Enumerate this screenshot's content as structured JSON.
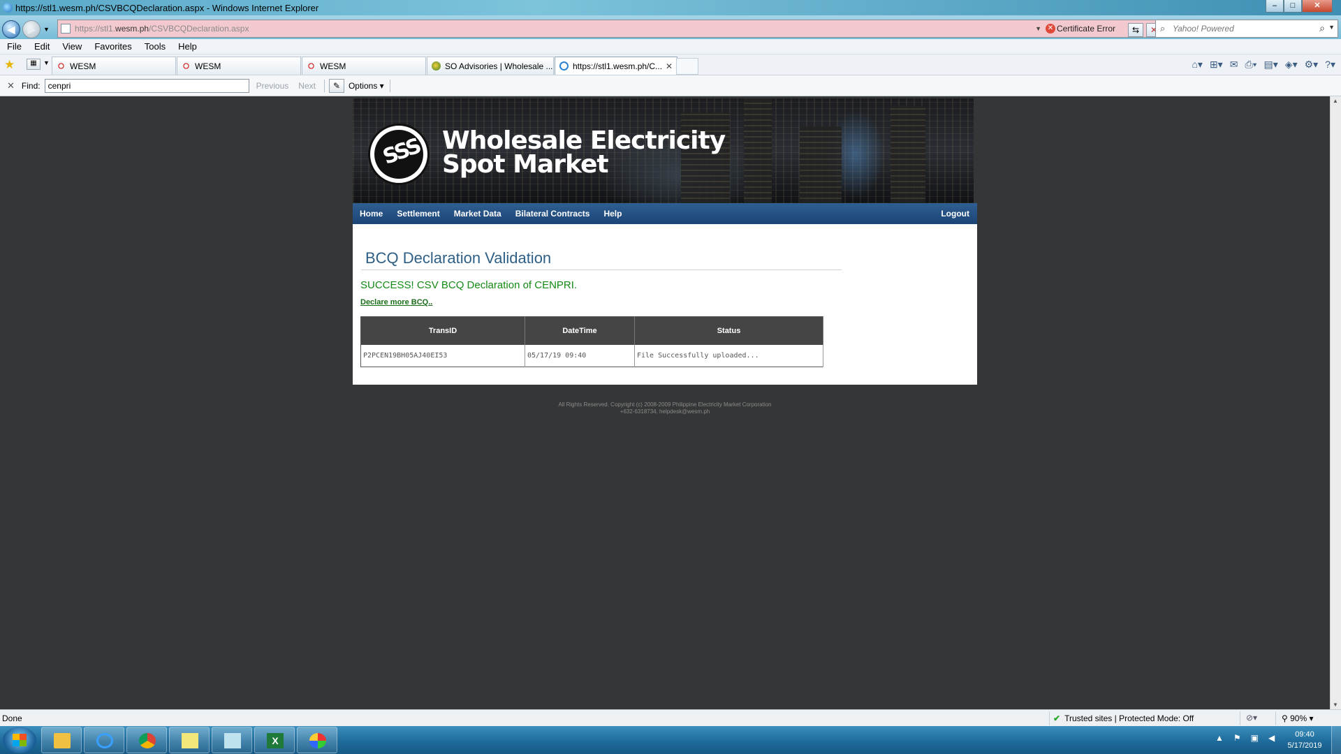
{
  "window": {
    "title": "https://stl1.wesm.ph/CSVBCQDeclaration.aspx - Windows Internet Explorer",
    "controls": {
      "minimize": "–",
      "maximize": "□",
      "close": "✕"
    }
  },
  "address_bar": {
    "url_prefix": "https://stl1.",
    "url_domain": "wesm.ph",
    "url_path": "/CSVBCQDeclaration.aspx",
    "certificate_error": "Certificate Error",
    "search_placeholder": "Yahoo! Powered"
  },
  "menu": [
    "File",
    "Edit",
    "View",
    "Favorites",
    "Tools",
    "Help"
  ],
  "tabs": [
    {
      "label": "WESM",
      "icon": "wesm-favicon-icon",
      "active": false
    },
    {
      "label": "WESM",
      "icon": "wesm-favicon-icon",
      "active": false
    },
    {
      "label": "WESM",
      "icon": "wesm-favicon-icon",
      "active": false
    },
    {
      "label": "SO Advisories | Wholesale ...",
      "icon": "so-favicon-icon",
      "active": false
    },
    {
      "label": "https://stl1.wesm.ph/C...",
      "icon": "ie-page-icon",
      "active": true
    }
  ],
  "command_bar_icons": [
    "home-icon",
    "feeds-icon",
    "read-mail-icon",
    "print-icon",
    "page-icon",
    "safety-icon",
    "tools-icon",
    "help-icon"
  ],
  "find_bar": {
    "close": "✕",
    "label": "Find:",
    "value": "cenpri",
    "previous": "Previous",
    "next": "Next",
    "options": "Options"
  },
  "site": {
    "brand_line1": "Wholesale Electricity",
    "brand_line2": "Spot Market",
    "nav": [
      "Home",
      "Settlement",
      "Market Data",
      "Bilateral Contracts",
      "Help"
    ],
    "logout": "Logout",
    "page_title": "BCQ Declaration Validation",
    "success_message": "SUCCESS! CSV BCQ Declaration of CENPRI.",
    "declare_more_link": "Declare more BCQ..",
    "table": {
      "headers": [
        "TransID",
        "DateTime",
        "Status"
      ],
      "rows": [
        [
          "P2PCEN19BH05AJ40EI53",
          "05/17/19 09:40",
          "File Successfully uploaded..."
        ]
      ]
    },
    "footer_line1": "All Rights Reserved. Copyright (c) 2008-2009 Philippine Electricity Market Corporation",
    "footer_line2": "+632-6318734, helpdesk@wesm.ph"
  },
  "status_bar": {
    "text": "Done",
    "zone": "Trusted sites | Protected Mode: Off",
    "zoom": "90%"
  },
  "taskbar": {
    "apps": [
      "windows-explorer-icon",
      "internet-explorer-icon",
      "chrome-icon",
      "sticky-notes-icon",
      "notepad-icon",
      "excel-icon",
      "paint-icon"
    ],
    "clock_time": "09:40",
    "clock_date": "5/17/2019"
  },
  "colors": {
    "page_background": "#353637",
    "nav_blue": "#1c4476",
    "title_blue": "#2e5f86",
    "success_green": "#138a13",
    "table_header": "#454545"
  }
}
